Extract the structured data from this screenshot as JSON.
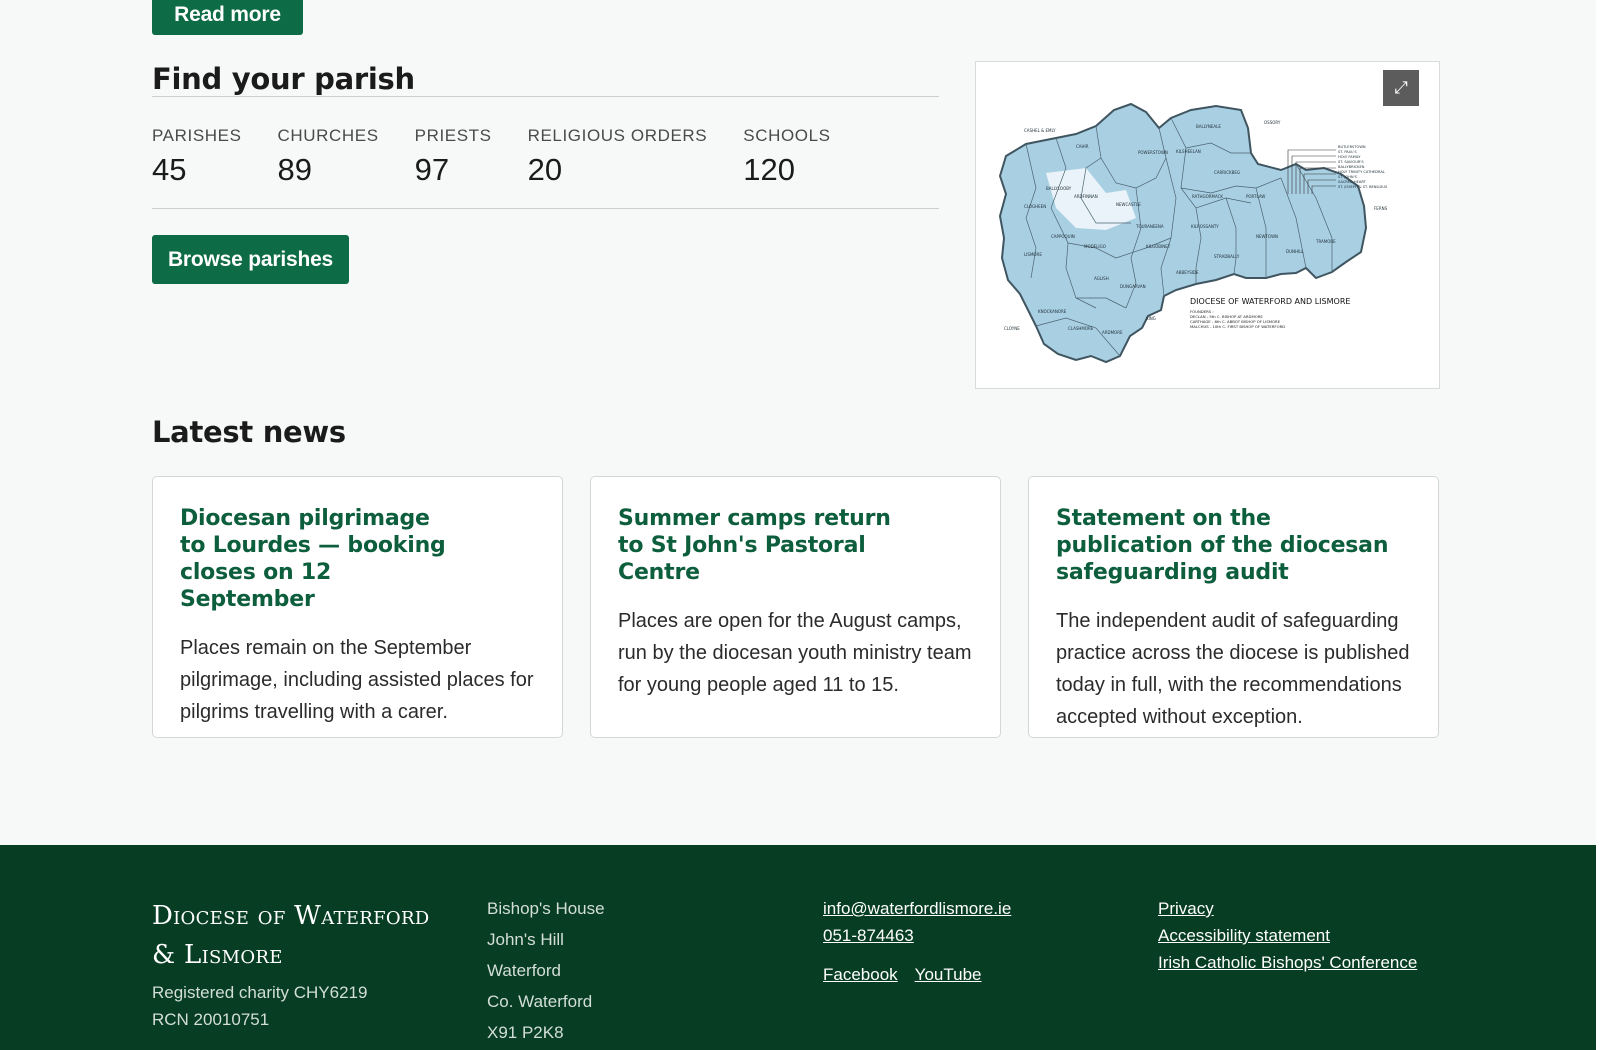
{
  "top": {
    "read_more_label": "Read more"
  },
  "parish": {
    "title": "Find your parish",
    "stats": [
      {
        "label": "PARISHES",
        "value": "45"
      },
      {
        "label": "CHURCHES",
        "value": "89"
      },
      {
        "label": "PRIESTS",
        "value": "97"
      },
      {
        "label": "RELIGIOUS ORDERS",
        "value": "20"
      },
      {
        "label": "SCHOOLS",
        "value": "120"
      }
    ],
    "browse_label": "Browse parishes"
  },
  "map": {
    "expand_icon": "⤢",
    "caption": "DIOCESE OF WATERFORD AND LISMORE",
    "founders_label": "FOUNDERS :",
    "founders": [
      "DECLAN - 5th C. BISHOP AT ARDMORE",
      "CARTHAGE - 6th C. ABBOT BISHOP OF LISMORE",
      "MALCHUS - 10th C. FIRST BISHOP OF WATERFORD"
    ],
    "outer_labels": [
      "CASHEL & EMLY",
      "OSSORY",
      "FERNS",
      "CLOYNE"
    ],
    "parish_labels": [
      "CAHIR",
      "BALLYLOOBY",
      "ARDFINNAN",
      "CLOGHEEN",
      "NEWCASTLE",
      "CAPPOQUIN",
      "MODELIGO",
      "AGLISH",
      "LISMORE",
      "KNOCKANORE",
      "CLASHMORE",
      "ARDMORE",
      "DUNGARVAN",
      "KING",
      "POWERSTOWN",
      "KILSHEELAN",
      "CARRICKBEG",
      "RATHGORMACK",
      "PORTLAW",
      "TOURANEENA",
      "KILGOBINET",
      "KILROSSANTY",
      "NEWTOWN",
      "STRADBALLY",
      "DUNHILL",
      "TRAMORE",
      "ABBEYSIDE",
      "BALLYNEALE",
      "BUTLERSTOWN",
      "ST. PAUL'S",
      "HOLY FAMILY",
      "ST. SAVIOUR'S",
      "BALLYBRICKEN",
      "HOLY TRINITY CATHEDRAL",
      "ST. JOHN'S",
      "SACRED HEART",
      "ST. JOSEPH & ST. BENILDUS"
    ]
  },
  "news": {
    "title": "Latest news",
    "items": [
      {
        "title": "Diocesan pilgrimage to Lourdes — booking closes on 12 September",
        "body": "Places remain on the September pilgrimage, including assisted places for pilgrims travelling with a carer."
      },
      {
        "title": "Summer camps return to St John's Pastoral Centre",
        "body": "Places are open for the August camps, run by the diocesan youth ministry team for young people aged 11 to 15."
      },
      {
        "title": "Statement on the publication of the diocesan safeguarding audit",
        "body": "The independent audit of safeguarding practice across the diocese is published today in full, with the recommendations accepted without exception."
      }
    ]
  },
  "footer": {
    "brand_line1": "Diocese of Waterford",
    "brand_line2": "& Lismore",
    "charity": "Registered charity CHY6219",
    "rcn": "RCN 20010751",
    "address": [
      "Bishop's House",
      "John's Hill",
      "Waterford",
      "Co. Waterford",
      "X91 P2K8"
    ],
    "email": "info@waterfordlismore.ie",
    "phone": "051-874463",
    "social": [
      "Facebook",
      "YouTube"
    ],
    "links": [
      "Privacy",
      "Accessibility statement",
      "Irish Catholic Bishops' Conference"
    ]
  },
  "colors": {
    "brand_green": "#0d6b45",
    "heading_green": "#0d5e3c",
    "footer_green": "#073d22",
    "map_fill": "#a9cfe3"
  }
}
